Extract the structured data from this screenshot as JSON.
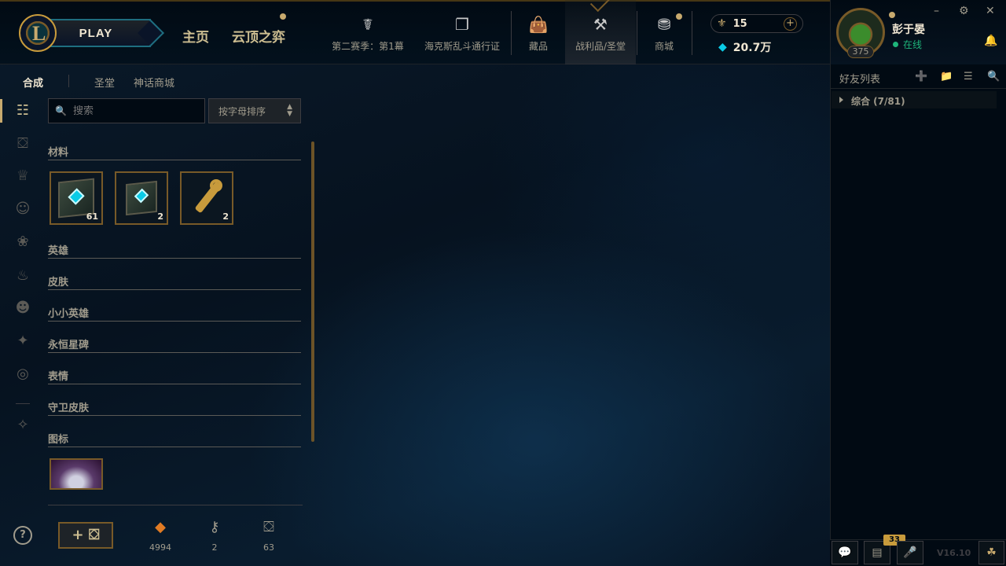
{
  "topbar": {
    "play_label": "PLAY",
    "nav_home": "主页",
    "nav_tft": "云顶之弈",
    "nav_items": [
      {
        "label": "第二赛季：第1幕",
        "icon": "season-icon"
      },
      {
        "label": "海克斯乱斗通行证",
        "icon": "pass-icon"
      },
      {
        "label": "藏品",
        "icon": "collection-icon"
      },
      {
        "label": "战利品/圣堂",
        "icon": "loot-icon"
      },
      {
        "label": "商城",
        "icon": "store-icon"
      }
    ],
    "active_nav": "战利品/圣堂",
    "rp_value": "15",
    "be_value": "20.7万"
  },
  "profile": {
    "name": "彭于晏",
    "status": "在线",
    "level": "375"
  },
  "subnav": {
    "tabs": [
      "合成",
      "圣堂",
      "神话商城"
    ],
    "active": "合成"
  },
  "filter": {
    "search_placeholder": "搜索",
    "sort_label": "按字母排序"
  },
  "categories": {
    "materials": "材料",
    "champions": "英雄",
    "skins": "皮肤",
    "little_legends": "小小英雄",
    "eternals": "永恒星碑",
    "emotes": "表情",
    "ward_skins": "守卫皮肤",
    "icons": "图标"
  },
  "materials": [
    {
      "name": "海克斯科技宝箱",
      "count": "61"
    },
    {
      "name": "海克斯科技宝箱(小)",
      "count": "2"
    },
    {
      "name": "钥匙",
      "count": "2"
    }
  ],
  "footer": {
    "craft_label": "+",
    "essence": [
      {
        "icon": "orange-essence-icon",
        "value": "4994"
      },
      {
        "icon": "key-fragment-icon",
        "value": "2"
      },
      {
        "icon": "chest-icon",
        "value": "63"
      }
    ]
  },
  "friends": {
    "title": "好友列表",
    "group_label": "综合 (7/81)",
    "badge_count": "33",
    "version": "V16.10"
  },
  "colors": {
    "gold": "#c8aa6e",
    "dark_gold": "#785a28",
    "bg": "#010a13",
    "online": "#1eb57a"
  }
}
